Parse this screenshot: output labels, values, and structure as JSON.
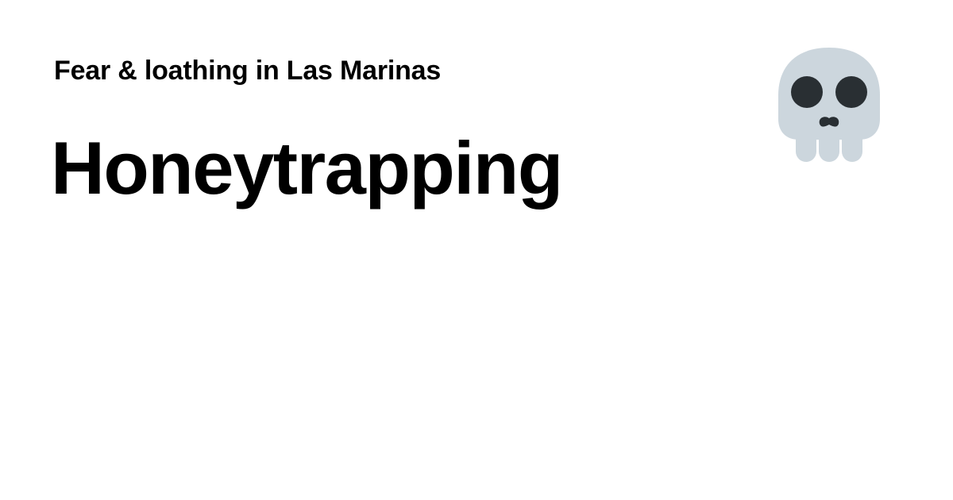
{
  "header": {
    "blog_name": "Fear & loathing in Las Marinas"
  },
  "post": {
    "title": "Honeytrapping"
  },
  "emoji": {
    "icon": "skull-icon",
    "colors": {
      "bone": "#CCD6DD",
      "shadow": "#292F33"
    }
  }
}
